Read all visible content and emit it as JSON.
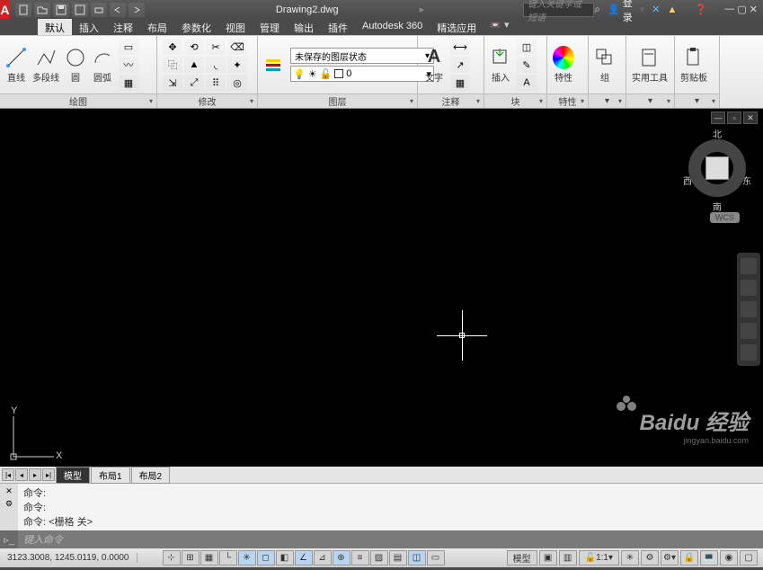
{
  "title": "Drawing2.dwg",
  "search_placeholder": "键入关键字或短语",
  "login_label": "登录",
  "menu": [
    "默认",
    "插入",
    "注释",
    "布局",
    "参数化",
    "视图",
    "管理",
    "输出",
    "插件",
    "Autodesk 360",
    "精选应用"
  ],
  "ribbon": {
    "draw": {
      "footer": "绘图",
      "line": "直线",
      "pline": "多段线",
      "circle": "圆",
      "arc": "圆弧"
    },
    "modify": {
      "footer": "修改"
    },
    "layer": {
      "footer": "图层",
      "state": "未保存的图层状态",
      "current": "0"
    },
    "text": {
      "footer": "注释",
      "label": "文字"
    },
    "insert": {
      "footer": "块",
      "label": "插入"
    },
    "props": {
      "footer": "特性",
      "label": "特性"
    },
    "group": {
      "label": "组"
    },
    "util": {
      "label": "实用工具"
    },
    "clip": {
      "label": "剪贴板"
    }
  },
  "viewcube": {
    "n": "北",
    "s": "南",
    "e": "东",
    "w": "西",
    "wcs": "WCS"
  },
  "ucs": {
    "x": "X",
    "y": "Y"
  },
  "tabs": {
    "model": "模型",
    "l1": "布局1",
    "l2": "布局2"
  },
  "cmd": {
    "prompt": "命令:",
    "grid": "<栅格 关>",
    "placeholder": "键入命令"
  },
  "status": {
    "coords": "3123.3008, 1245.0119, 0.0000",
    "model": "模型",
    "scale": "1:1"
  },
  "watermark": {
    "brand": "Baidu 经验",
    "url": "jingyan.baidu.com"
  }
}
